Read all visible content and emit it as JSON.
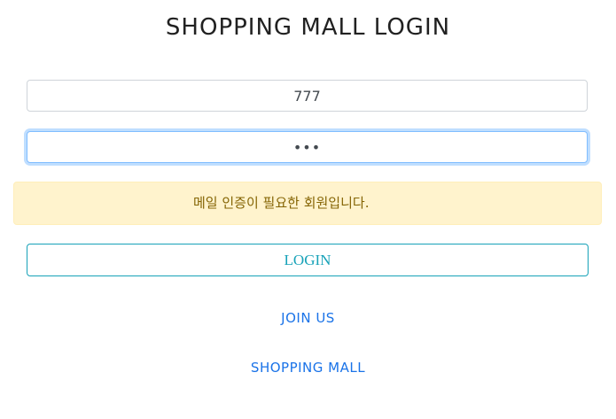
{
  "page": {
    "title": "SHOPPING MALL LOGIN"
  },
  "form": {
    "username_value": "777",
    "password_value": "•••"
  },
  "alert": {
    "message": "메일 인증이 필요한 회원입니다."
  },
  "buttons": {
    "login_label": "LOGIN"
  },
  "links": {
    "join_label": "JOIN US",
    "mall_label": "SHOPPING MALL"
  },
  "colors": {
    "alert_bg": "#fff3cd",
    "alert_text": "#856404",
    "login_border": "#17a2b8",
    "link": "#1a73e8"
  }
}
